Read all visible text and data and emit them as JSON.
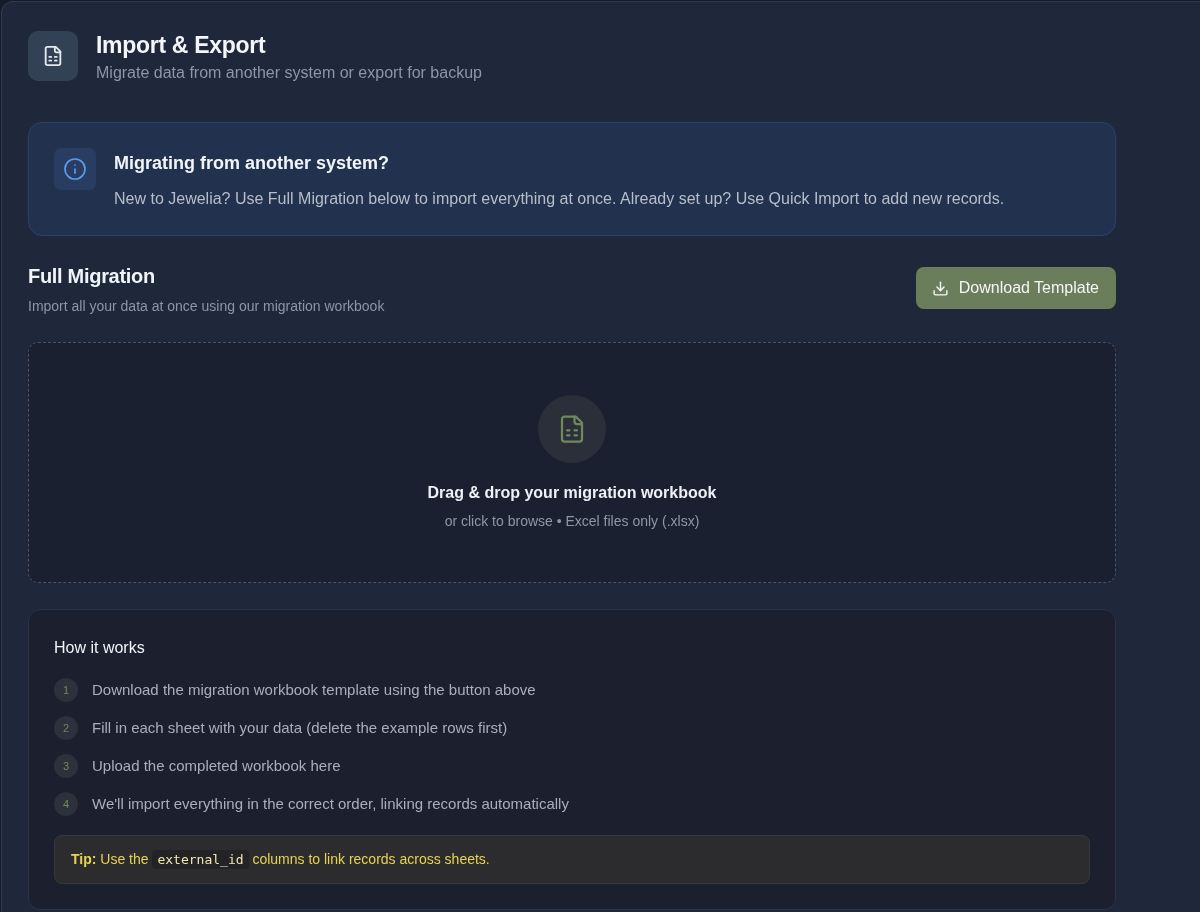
{
  "header": {
    "title": "Import & Export",
    "subtitle": "Migrate data from another system or export for backup"
  },
  "notice": {
    "title": "Migrating from another system?",
    "body": "New to Jewelia? Use Full Migration below to import everything at once. Already set up? Use Quick Import to add new records."
  },
  "full_migration": {
    "title": "Full Migration",
    "subtitle": "Import all your data at once using our migration workbook",
    "download_button": "Download Template"
  },
  "dropzone": {
    "title": "Drag & drop your migration workbook",
    "hint": "or click to browse • Excel files only (.xlsx)"
  },
  "how_it_works": {
    "title": "How it works",
    "steps": [
      {
        "number": "1",
        "text": "Download the migration workbook template using the button above"
      },
      {
        "number": "2",
        "text": "Fill in each sheet with your data (delete the example rows first)"
      },
      {
        "number": "3",
        "text": "Upload the completed workbook here"
      },
      {
        "number": "4",
        "text": "We'll import everything in the correct order, linking records automatically"
      }
    ],
    "tip": {
      "lead": "**Tip:** Use the",
      "code": "external_id",
      "after": "columns to link records across sheets."
    }
  }
}
